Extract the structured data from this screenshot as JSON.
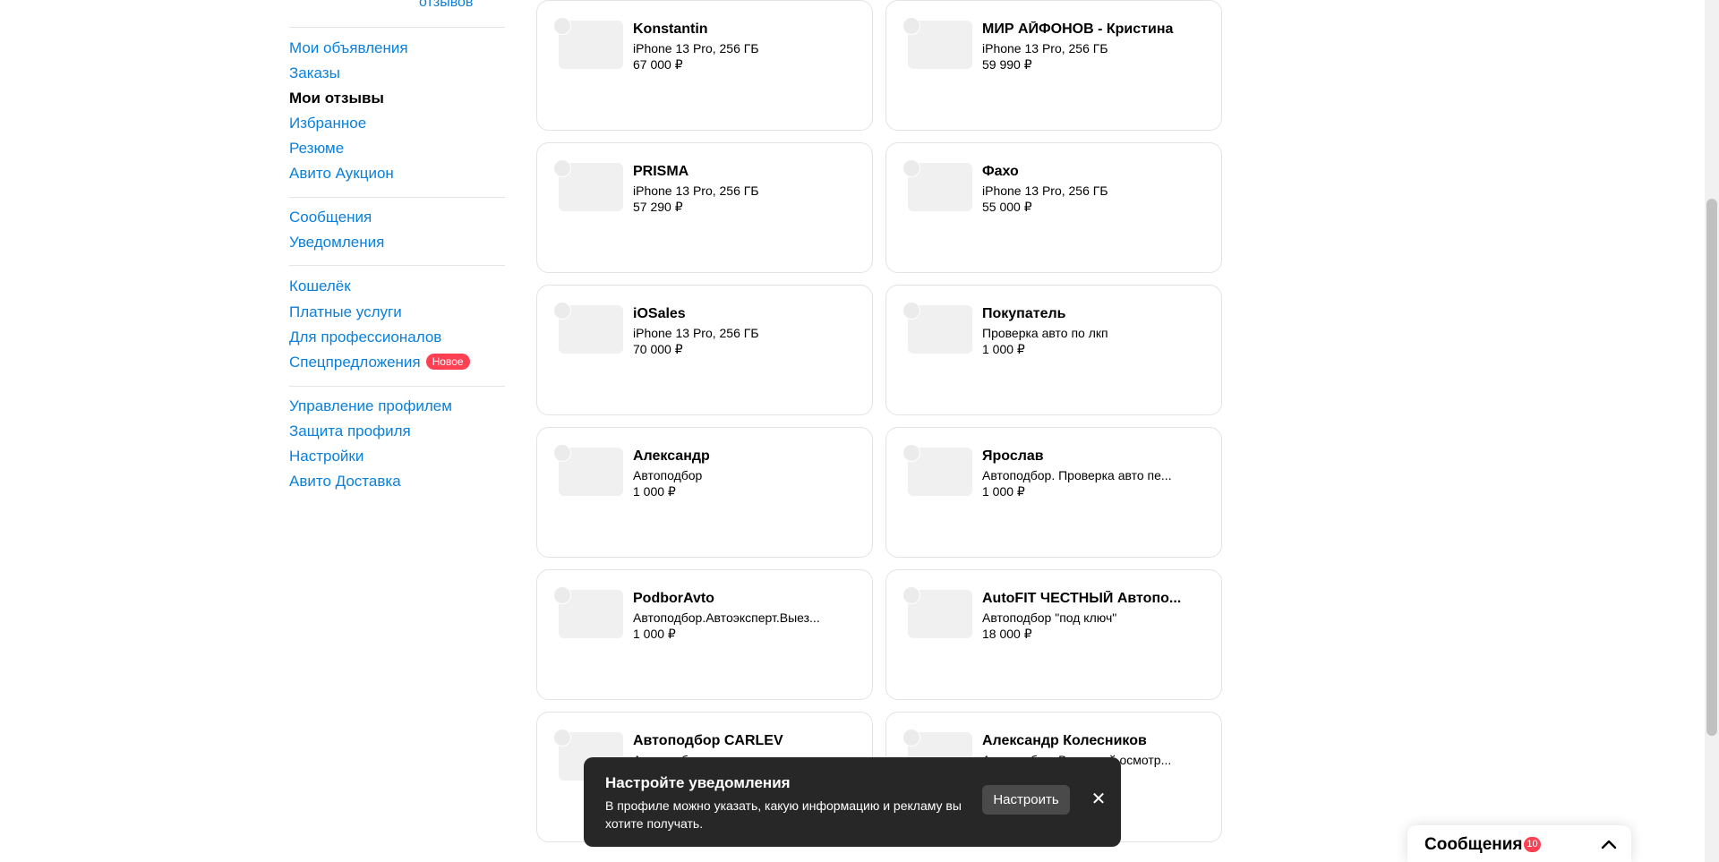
{
  "sidebar": {
    "top_fragment": "отзывов",
    "groups": [
      [
        {
          "label": "Мои объявления",
          "active": false
        },
        {
          "label": "Заказы",
          "active": false
        },
        {
          "label": "Мои отзывы",
          "active": true
        },
        {
          "label": "Избранное",
          "active": false
        },
        {
          "label": "Резюме",
          "active": false
        },
        {
          "label": "Авито Аукцион",
          "active": false
        }
      ],
      [
        {
          "label": "Сообщения",
          "active": false
        },
        {
          "label": "Уведомления",
          "active": false
        }
      ],
      [
        {
          "label": "Кошелёк",
          "active": false
        },
        {
          "label": "Платные услуги",
          "active": false
        },
        {
          "label": "Для профессионалов",
          "active": false
        },
        {
          "label": "Спецпредложения",
          "active": false,
          "badge": "Новое"
        }
      ],
      [
        {
          "label": "Управление профилем",
          "active": false
        },
        {
          "label": "Защита профиля",
          "active": false
        },
        {
          "label": "Настройки",
          "active": false
        },
        {
          "label": "Авито Доставка",
          "active": false
        }
      ]
    ]
  },
  "reviews": [
    {
      "seller": "Konstantin",
      "item": "iPhone 13 Pro, 256 ГБ",
      "price": "67 000 ₽"
    },
    {
      "seller": "МИР АЙФОНОВ - Кристина",
      "item": "iPhone 13 Pro, 256 ГБ",
      "price": "59 990 ₽"
    },
    {
      "seller": "PRISMA",
      "item": "iPhone 13 Pro, 256 ГБ",
      "price": "57 290 ₽"
    },
    {
      "seller": "Фахо",
      "item": "iPhone 13 Pro, 256 ГБ",
      "price": "55 000 ₽"
    },
    {
      "seller": "iOSales",
      "item": "iPhone 13 Pro, 256 ГБ",
      "price": "70 000 ₽"
    },
    {
      "seller": "Покупатель",
      "item": "Проверка авто по лкп",
      "price": "1 000 ₽"
    },
    {
      "seller": "Александр",
      "item": "Автоподбор",
      "price": "1 000 ₽"
    },
    {
      "seller": "Ярослав",
      "item": "Автоподбор. Проверка авто пе...",
      "price": "1 000 ₽"
    },
    {
      "seller": "PodborAvto",
      "item": "Автоподбор.Автоэксперт.Выез...",
      "price": "1 000 ₽"
    },
    {
      "seller": "AutoFIT ЧЕСТНЫЙ Автопо...",
      "item": "Автоподбор \"под ключ\"",
      "price": "18 000 ₽"
    },
    {
      "seller": "Автоподбор CARLEV",
      "item": "Автоподбор под ключ, поиск и...",
      "price": ""
    },
    {
      "seller": "Александр Колесников",
      "item": "Автоподбор. Выездной осмотр...",
      "price": ""
    }
  ],
  "toast": {
    "title": "Настройте уведомления",
    "body": "В профиле можно указать, какую информацию и рекламу вы хотите получать.",
    "button": "Настроить"
  },
  "messages_dock": {
    "label": "Сообщения",
    "count": "10"
  },
  "colors": {
    "link": "#0a7fdb",
    "badge": "#ff4053",
    "toast_bg": "#272727"
  }
}
